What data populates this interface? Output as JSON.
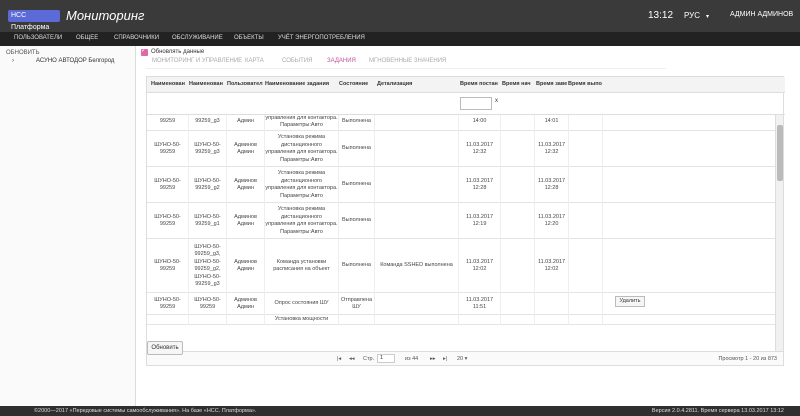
{
  "header": {
    "logo_text": "НСС Платформа",
    "app_title": "Мониторинг",
    "clock": "13:12",
    "language": "РУС",
    "user": "АДМИН АДМИНОВ"
  },
  "menu": [
    "ПОЛЬЗОВАТЕЛИ",
    "ОБЩЕЕ",
    "СПРАВОЧНИКИ",
    "ОБСЛУЖИВАНИЕ",
    "ОБЪЕКТЫ",
    "УЧЁТ ЭНЕРГОПОТРЕБЛЕНИЯ"
  ],
  "sidebar": {
    "refresh_label": "ОБНОВИТЬ",
    "tree_arrow": "›",
    "tree_node": "АСУНО АВТОДОР Белгород"
  },
  "main": {
    "auto_refresh_label": "Обновлять данные",
    "tabs": [
      "МОНИТОРИНГ И УПРАВЛЕНИЕ",
      "КАРТА",
      "СОБЫТИЯ",
      "ЗАДАНИЯ",
      "МГНОВЕННЫЕ ЗНАЧЕНИЯ"
    ],
    "active_tab": "ЗАДАНИЯ",
    "columns": [
      "Наименован",
      "Наименован",
      "Пользовател",
      "Наименование задания",
      "Состояние",
      "Детализация",
      "Время постан",
      "Время нач",
      "Время заве",
      "Время выпол"
    ],
    "filter_clear": "x",
    "rows": [
      {
        "c1": "99259",
        "c2": "99259_g3",
        "user": "Админ",
        "task": "управления для контактора.\nПараметры:Авто",
        "state": "Выполнена",
        "detail": "",
        "t_set": "14:00",
        "t_start": "",
        "t_end": "14:01",
        "t_exec": ""
      },
      {
        "c1": "ШУНО-50-\n99259",
        "c2": "ШУНО-50-\n99259_g3",
        "user": "Админов\nАдмин",
        "task": "Установка режима\nдистанционного\nуправления для контактора.\nПараметры:Авто",
        "state": "Выполнена",
        "detail": "",
        "t_set": "11.03.2017\n12:32",
        "t_start": "",
        "t_end": "11.03.2017\n12:32",
        "t_exec": ""
      },
      {
        "c1": "ШУНО-50-\n99259",
        "c2": "ШУНО-50-\n99259_g2",
        "user": "Админов\nАдмин",
        "task": "Установка режима\nдистанционного\nуправления для контактора.\nПараметры:Авто",
        "state": "Выполнена",
        "detail": "",
        "t_set": "11.03.2017\n12:28",
        "t_start": "",
        "t_end": "11.03.2017\n12:28",
        "t_exec": ""
      },
      {
        "c1": "ШУНО-50-\n99259",
        "c2": "ШУНО-50-\n99259_g1",
        "user": "Админов\nАдмин",
        "task": "Установка режима\nдистанционного\nуправления для контактора.\nПараметры:Авто",
        "state": "Выполнена",
        "detail": "",
        "t_set": "11.03.2017\n12:19",
        "t_start": "",
        "t_end": "11.03.2017\n12:20",
        "t_exec": ""
      },
      {
        "c1": "ШУНО-50-\n99259",
        "c2": "ШУНО-50-\n99259_g3,\nШУНО-50-\n99259_g2,\nШУНО-50-\n99259_g3",
        "user": "Админов\nАдмин",
        "task": "Команда установки\nрасписания на объект",
        "state": "Выполнена",
        "detail": "Команда SSHED выполнена",
        "t_set": "11.03.2017\n12:02",
        "t_start": "",
        "t_end": "11.03.2017\n12:02",
        "t_exec": ""
      },
      {
        "c1": "ШУНО-50-\n99259",
        "c2": "ШУНО-50-\n99259",
        "user": "Админов\nАдмин",
        "task": "Опрос состояния ШУ",
        "state": "Отправлена\nШУ",
        "detail": "",
        "t_set": "11.03.2017\n11:51",
        "t_start": "",
        "t_end": "",
        "t_exec": ""
      },
      {
        "c1": "",
        "c2": "",
        "user": "",
        "task": "Установка мощности",
        "state": "",
        "detail": "",
        "t_set": "",
        "t_start": "",
        "t_end": "",
        "t_exec": ""
      }
    ],
    "delete_label": "Удалить",
    "pager": {
      "first": "|◂",
      "prev": "◂◂",
      "page_label": "Стр.",
      "page": "1",
      "of_label": "из 44",
      "next": "▸▸",
      "last": "▸|",
      "per_page": "20 ▾",
      "summary": "Просмотр 1 - 20 из 873"
    },
    "refresh_button": "Обновить"
  },
  "footer": {
    "left": "©2000—2017 «Передовые системы самообслуживания». На базе «НСС. Платформа».",
    "right": "Версия 2.0.4.2811. Время сервера 13.03.2017 13:12"
  },
  "colors": {
    "accent": "#c0569a",
    "topbar": "#3a3a3a",
    "menubar": "#222222"
  }
}
